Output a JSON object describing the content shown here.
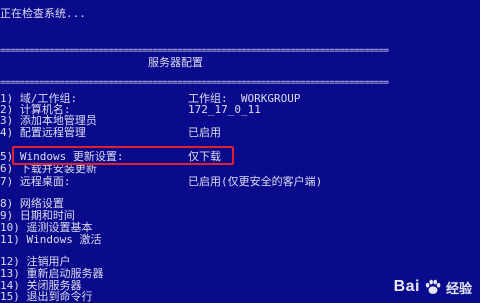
{
  "status_line": "正在检查系统...",
  "separator": "===============================================================================",
  "title": "服务器配置",
  "items": [
    {
      "key": "1) 域/工作组:",
      "value": "工作组:  WORKGROUP"
    },
    {
      "key": "2) 计算机名:",
      "value": "172_17_0_11"
    },
    {
      "key": "3) 添加本地管理员",
      "value": ""
    },
    {
      "key": "4) 配置远程管理",
      "value": "已启用"
    },
    {
      "key": "5) Windows 更新设置:",
      "value": "仅下载"
    },
    {
      "key": "6) 下载并安装更新",
      "value": ""
    },
    {
      "key": "7) 远程桌面:",
      "value": "已启用(仅更安全的客户端)"
    },
    {
      "key": "8) 网络设置",
      "value": ""
    },
    {
      "key": "9) 日期和时间",
      "value": ""
    },
    {
      "key": "10) 遥测设置基本",
      "value": ""
    },
    {
      "key": "11) Windows 激活",
      "value": ""
    },
    {
      "key": "12) 注销用户",
      "value": ""
    },
    {
      "key": "13) 重新启动服务器",
      "value": ""
    },
    {
      "key": "14) 关闭服务器",
      "value": ""
    },
    {
      "key": "15) 退出到命令行",
      "value": ""
    }
  ],
  "watermark": {
    "brand": "Bai",
    "brand_suffix": "经验",
    "icon": "baidu-paw-icon"
  },
  "colors": {
    "background": "#0a0a8c",
    "text": "#dcdcf0",
    "highlight": "#e0202a"
  }
}
